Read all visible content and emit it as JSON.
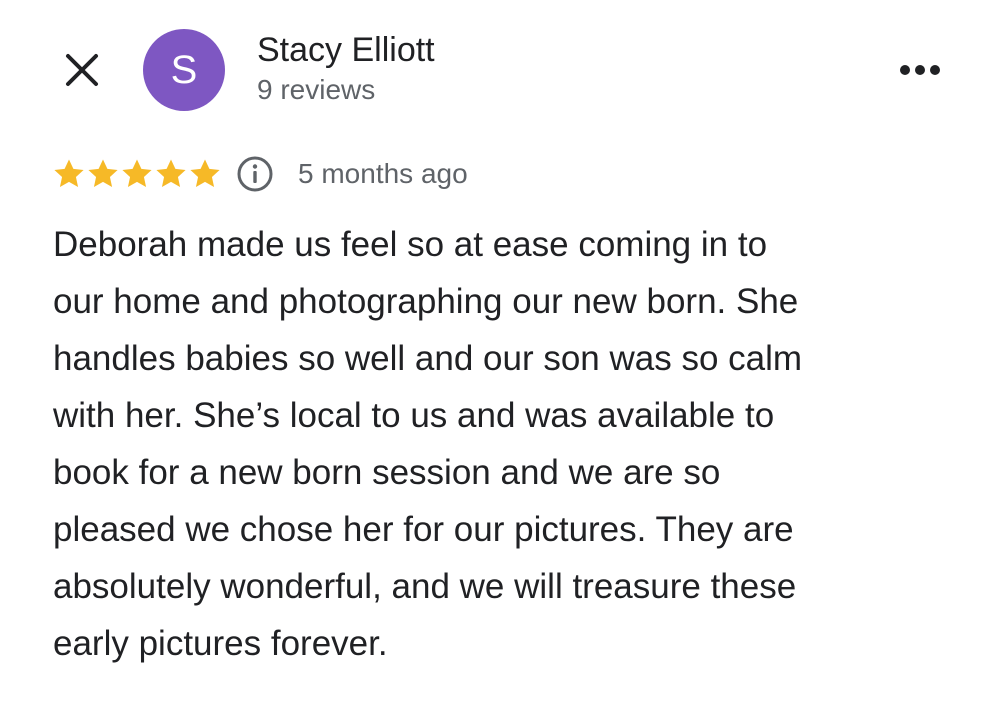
{
  "header": {
    "close_icon": "close-icon",
    "avatar_letter": "S",
    "avatar_color": "#7e57c2",
    "author_name": "Stacy Elliott",
    "review_count": "9 reviews",
    "more_icon": "more-horizontal-icon"
  },
  "review": {
    "rating": 5,
    "rating_max": 5,
    "star_color": "#f6b927",
    "info_icon": "info-icon",
    "time_ago": "5 months ago",
    "lines": [
      "Deborah made us feel so at ease coming in to",
      "our home and photographing our new born. She",
      "handles babies so well and our son was so calm",
      "with her. She’s local to us and was available to",
      "book for a new born session and we are so",
      "pleased we chose her for our pictures. They are",
      "absolutely wonderful, and we will treasure these",
      "early pictures forever."
    ]
  }
}
